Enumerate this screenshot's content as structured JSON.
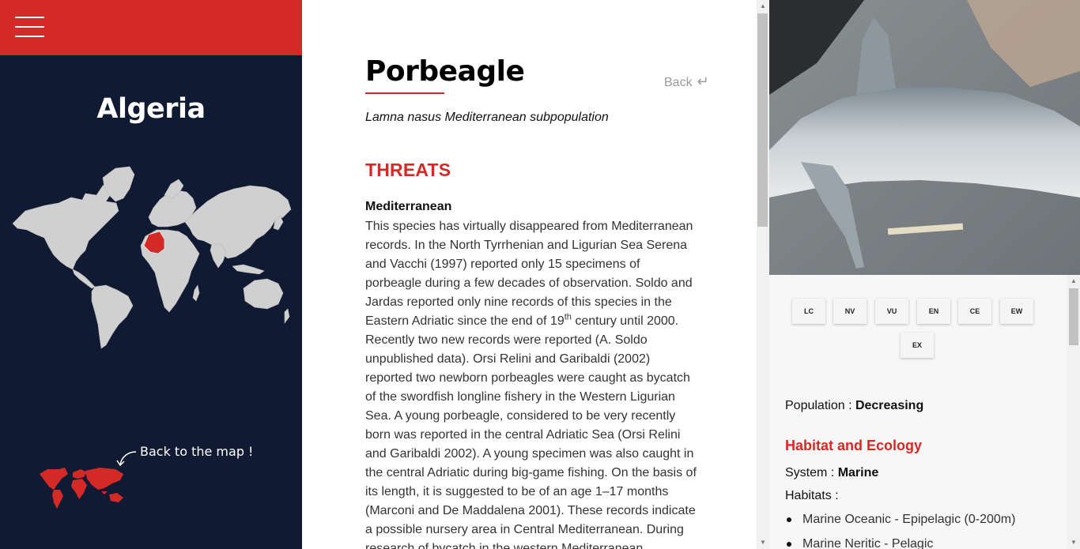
{
  "nav": {
    "menu_icon": "hamburger-menu-icon"
  },
  "left": {
    "country": "Algeria",
    "back_to_map": "Back to the map !",
    "colors": {
      "panel": "#111a33",
      "accent": "#d32a27",
      "land": "#d0d0d0"
    }
  },
  "species": {
    "name": "Porbeagle",
    "scientific": "Lamna nasus Mediterranean subpopulation",
    "back_label": "Back",
    "back_icon": "return-arrow-icon"
  },
  "threats": {
    "title": "THREATS",
    "region": "Mediterranean",
    "text_before_sup": "This species has virtually disappeared from Mediterranean records. In the North Tyrrhenian and Ligurian Sea Serena and Vacchi (1997) reported only 15 specimens of porbeagle during a few decades of observation. Soldo and Jardas reported only nine records of this species in the Eastern Adriatic since the end of 19",
    "sup": "th",
    "text_after_sup": " century until 2000. Recently two new records were reported (A. Soldo unpublished data). Orsi Relini and Garibaldi (2002) reported two newborn porbeagles were caught as bycatch of the swordfish longline fishery in the Western Ligurian Sea. A young porbeagle, considered to be very recently born was reported in the central Adriatic Sea (Orsi Relini and Garibaldi 2002). A young specimen was also caught in the central Adriatic during big-game fishing. On the basis of its length, it is suggested to be of an age 1–17 months (Marconi and De Maddalena 2001). These records indicate a possible nursery area in Central Mediterranean. During research of bycatch in the western Mediterranean"
  },
  "status_buttons": [
    "LC",
    "NV",
    "VU",
    "EN",
    "CE",
    "EW",
    "EX"
  ],
  "population": {
    "label": "Population : ",
    "value": "Decreasing"
  },
  "habitat": {
    "title": "Habitat and Ecology",
    "system_label": "System : ",
    "system_value": "Marine",
    "habitats_label": "Habitats :",
    "items": [
      "Marine Oceanic - Epipelagic (0-200m)",
      "Marine Neritic - Pelagic"
    ]
  }
}
